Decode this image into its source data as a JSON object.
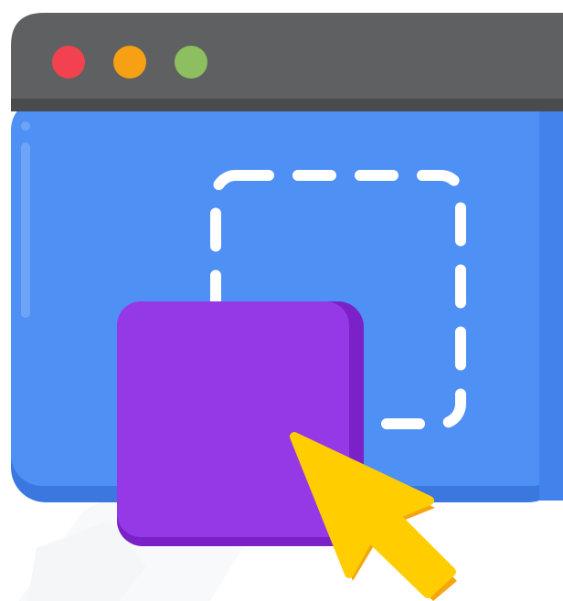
{
  "illustration": {
    "subject": "drag-and-drop",
    "window": {
      "titlebar_color": "#5f6062",
      "body_color": "#4f90f5",
      "buttons": [
        {
          "name": "close",
          "color": "#f2424f"
        },
        {
          "name": "minimize",
          "color": "#f7a013"
        },
        {
          "name": "maximize",
          "color": "#8dbe5f"
        }
      ]
    },
    "drop_zone": {
      "style": "dashed",
      "color": "#ffffff"
    },
    "dragged_item": {
      "color": "#9539e6",
      "shadow_color": "#7a22c8"
    },
    "cursor": {
      "type": "arrow",
      "color": "#ffcd00",
      "shadow_color": "#f3a60e"
    }
  }
}
